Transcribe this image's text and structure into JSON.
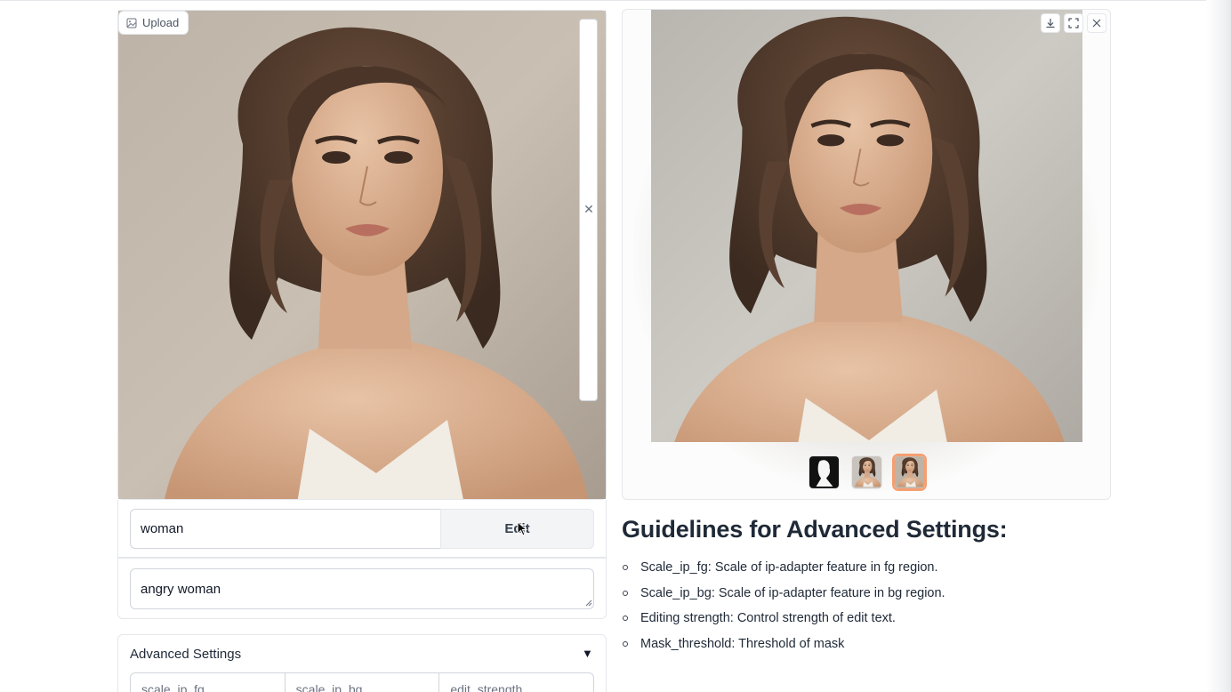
{
  "upload_label": "Upload",
  "target_input": {
    "value": "woman"
  },
  "edit_button": {
    "label": "Edit"
  },
  "prompt_input": {
    "value": "angry woman"
  },
  "advanced": {
    "label": "Advanced Settings",
    "toggle_icon": "▼",
    "fields": [
      "scale_ip_fg",
      "scale_ip_bg",
      "edit_strength"
    ]
  },
  "gallery": {
    "thumbs": [
      "mask-thumbnail",
      "original-thumbnail",
      "edited-thumbnail"
    ],
    "selected_index": 2
  },
  "guidelines": {
    "title": "Guidelines for Advanced Settings:",
    "items": [
      "Scale_ip_fg: Scale of ip-adapter feature in fg region.",
      "Scale_ip_bg: Scale of ip-adapter feature in bg region.",
      "Editing strength: Control strength of edit text.",
      "Mask_threshold: Threshold of mask"
    ]
  },
  "icons": {
    "upload": "image-icon",
    "clear": "close-icon",
    "download": "download-icon",
    "fullscreen": "fullscreen-icon",
    "close": "close-icon"
  },
  "colors": {
    "accent": "#f59e72",
    "button_bg": "#f3f4f6",
    "border": "#e5e7eb"
  }
}
